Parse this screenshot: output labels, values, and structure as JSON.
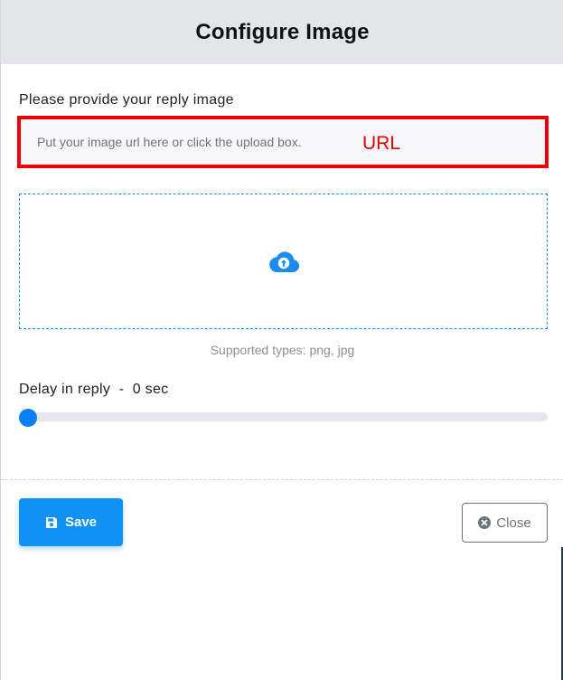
{
  "header": {
    "title": "Configure Image"
  },
  "image_field": {
    "label": "Please provide your reply image",
    "placeholder": "Put your image url here or click the upload box.",
    "value": "",
    "annotation": "URL",
    "annotation_color": "#ee0000"
  },
  "upload": {
    "icon": "cloud-upload-icon",
    "supported_types": "Supported types: png, jpg"
  },
  "delay": {
    "label": "Delay in reply  -  0 sec",
    "value_sec": 0
  },
  "footer": {
    "save_label": "Save",
    "save_icon": "save-icon",
    "close_label": "Close",
    "close_icon": "close-circle-icon"
  },
  "colors": {
    "primary": "#1091f4",
    "header_bg": "#e2e6ea",
    "slider_thumb": "#0d7ff2"
  }
}
